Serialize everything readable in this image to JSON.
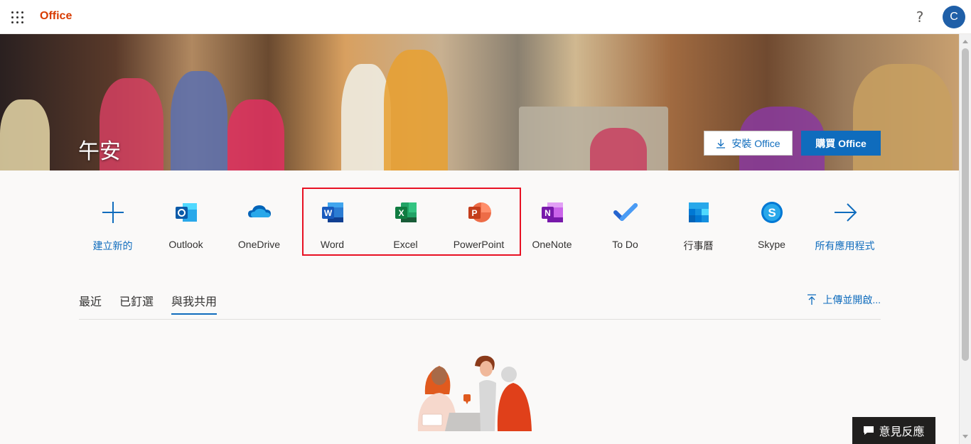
{
  "topbar": {
    "brand": "Office",
    "help_symbol": "?",
    "avatar_initial": "C"
  },
  "hero": {
    "greeting": "午安",
    "install_label": "安裝 Office",
    "buy_label": "購買 Office"
  },
  "apps": [
    {
      "label": "建立新的",
      "icon": "plus-icon",
      "color": "#0f6cbd"
    },
    {
      "label": "Outlook",
      "icon": "outlook-icon",
      "color": "#0078d4"
    },
    {
      "label": "OneDrive",
      "icon": "onedrive-icon",
      "color": "#0364b8"
    },
    {
      "label": "Word",
      "icon": "word-icon",
      "color": "#185abd"
    },
    {
      "label": "Excel",
      "icon": "excel-icon",
      "color": "#107c41"
    },
    {
      "label": "PowerPoint",
      "icon": "powerpoint-icon",
      "color": "#c43e1c"
    },
    {
      "label": "OneNote",
      "icon": "onenote-icon",
      "color": "#7719aa"
    },
    {
      "label": "To Do",
      "icon": "todo-icon",
      "color": "#2564cf"
    },
    {
      "label": "行事曆",
      "icon": "calendar-icon",
      "color": "#0078d4"
    },
    {
      "label": "Skype",
      "icon": "skype-icon",
      "color": "#0078d4"
    },
    {
      "label": "所有應用程式",
      "icon": "arrow-right-icon",
      "color": "#0f6cbd"
    }
  ],
  "tabs": [
    {
      "label": "最近"
    },
    {
      "label": "已釘選"
    },
    {
      "label": "與我共用",
      "active": true
    }
  ],
  "upload_label": "上傳並開啟...",
  "feedback_label": "意見反應",
  "colors": {
    "accent": "#0f6cbd",
    "brand": "#d83b01",
    "highlight": "#e81123"
  }
}
